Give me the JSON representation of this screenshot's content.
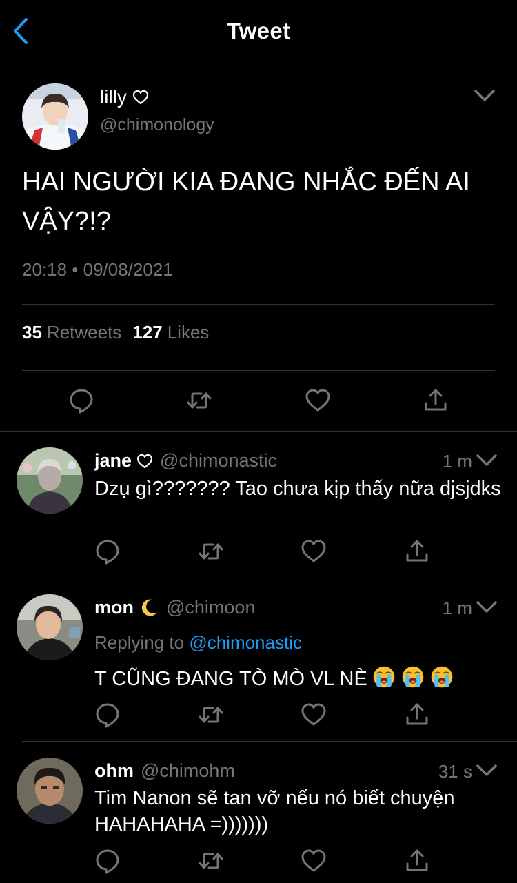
{
  "nav": {
    "title": "Tweet",
    "back_icon": "chevron-left-icon"
  },
  "colors": {
    "background": "#000000",
    "accent": "#1d9bf0",
    "secondary_text": "#71767b",
    "divider": "#2f3336"
  },
  "main_tweet": {
    "author_name": "lilly",
    "author_handle": "@chimonology",
    "text": "HAI NGƯỜI KIA ĐANG NHẮC ĐẾN AI VẬY?!?",
    "timestamp": "20:18 • 09/08/2021",
    "retweets_count": "35",
    "retweets_label": "Retweets",
    "likes_count": "127",
    "likes_label": "Likes"
  },
  "replies": [
    {
      "name": "jane",
      "handle": "@chimonastic",
      "time": "1 m",
      "text": "Dzụ gì??????? Tao chưa kịp thấy nữa djsjdks"
    },
    {
      "name": "mon",
      "handle": "@chimoon",
      "time": "1 m",
      "replying_prefix": "Replying to",
      "replying_mention": "@chimonastic",
      "text": "T CŨNG ĐANG TÒ MÒ VL NÈ"
    },
    {
      "name": "ohm",
      "handle": "@chimohm",
      "time": "31 s",
      "text": "Tim Nanon sẽ tan vỡ nếu nó biết chuyện HAHAHAHA =)))))))"
    }
  ],
  "actions": [
    "reply-icon",
    "retweet-icon",
    "like-icon",
    "share-icon"
  ]
}
